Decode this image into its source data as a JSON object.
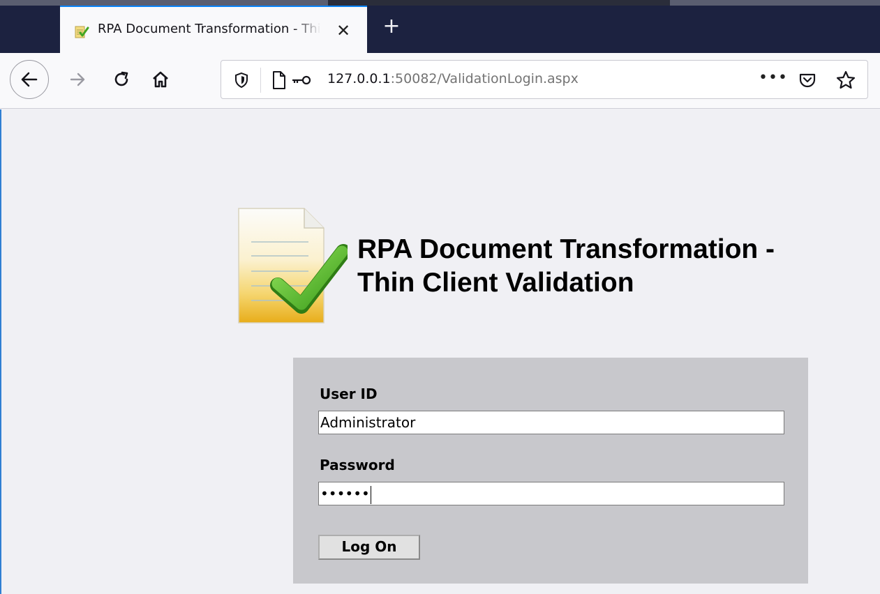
{
  "browser": {
    "active_tab": {
      "title": "RPA Document Transformation - Thin Client Validation",
      "favicon": "document-check-icon"
    },
    "new_tab_glyph": "+",
    "close_glyph": "✕",
    "url": {
      "host": "127.0.0.1",
      "rest": ":50082/ValidationLogin.aspx"
    },
    "more_glyph": "•••"
  },
  "page": {
    "title_line1": "RPA Document Transformation -",
    "title_line2": "Thin Client Validation",
    "login": {
      "user_label": "User ID",
      "user_value": "Administrator",
      "password_label": "Password",
      "password_masked": "••••••",
      "logon_label": "Log On"
    }
  },
  "colors": {
    "tabstrip": "#1c2240",
    "accent": "#0a84ff",
    "page_bg": "#f0f0f4",
    "panel_bg": "#c8c8cc",
    "check_green": "#5cbf2a"
  }
}
